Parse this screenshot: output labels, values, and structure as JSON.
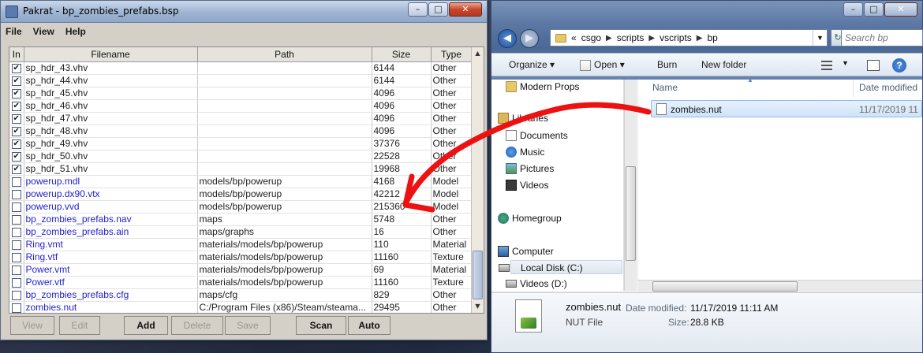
{
  "pakrat": {
    "title": "Pakrat - bp_zombies_prefabs.bsp",
    "menu": [
      "File",
      "View",
      "Help"
    ],
    "columns": [
      "In",
      "Filename",
      "Path",
      "Size",
      "Type"
    ],
    "rows": [
      {
        "checked": true,
        "name": "sp_hdr_43.vhv",
        "path": "",
        "size": "6144",
        "type": "Other"
      },
      {
        "checked": true,
        "name": "sp_hdr_44.vhv",
        "path": "",
        "size": "6144",
        "type": "Other"
      },
      {
        "checked": true,
        "name": "sp_hdr_45.vhv",
        "path": "",
        "size": "4096",
        "type": "Other"
      },
      {
        "checked": true,
        "name": "sp_hdr_46.vhv",
        "path": "",
        "size": "4096",
        "type": "Other"
      },
      {
        "checked": true,
        "name": "sp_hdr_47.vhv",
        "path": "",
        "size": "4096",
        "type": "Other"
      },
      {
        "checked": true,
        "name": "sp_hdr_48.vhv",
        "path": "",
        "size": "4096",
        "type": "Other"
      },
      {
        "checked": true,
        "name": "sp_hdr_49.vhv",
        "path": "",
        "size": "37376",
        "type": "Other"
      },
      {
        "checked": true,
        "name": "sp_hdr_50.vhv",
        "path": "",
        "size": "22528",
        "type": "Other"
      },
      {
        "checked": true,
        "name": "sp_hdr_51.vhv",
        "path": "",
        "size": "19968",
        "type": "Other"
      },
      {
        "checked": false,
        "name": "powerup.mdl",
        "path": "models/bp/powerup",
        "size": "4168",
        "type": "Model"
      },
      {
        "checked": false,
        "name": "powerup.dx90.vtx",
        "path": "models/bp/powerup",
        "size": "42212",
        "type": "Model"
      },
      {
        "checked": false,
        "name": "powerup.vvd",
        "path": "models/bp/powerup",
        "size": "215360",
        "type": "Model"
      },
      {
        "checked": false,
        "name": "bp_zombies_prefabs.nav",
        "path": "maps",
        "size": "5748",
        "type": "Other"
      },
      {
        "checked": false,
        "name": "bp_zombies_prefabs.ain",
        "path": "maps/graphs",
        "size": "16",
        "type": "Other"
      },
      {
        "checked": false,
        "name": "Ring.vmt",
        "path": "materials/models/bp/powerup",
        "size": "110",
        "type": "Material"
      },
      {
        "checked": false,
        "name": "Ring.vtf",
        "path": "materials/models/bp/powerup",
        "size": "11160",
        "type": "Texture"
      },
      {
        "checked": false,
        "name": "Power.vmt",
        "path": "materials/models/bp/powerup",
        "size": "69",
        "type": "Material"
      },
      {
        "checked": false,
        "name": "Power.vtf",
        "path": "materials/models/bp/powerup",
        "size": "11160",
        "type": "Texture"
      },
      {
        "checked": false,
        "name": "bp_zombies_prefabs.cfg",
        "path": "maps/cfg",
        "size": "829",
        "type": "Other"
      },
      {
        "checked": false,
        "name": "zombies.nut",
        "path": "C:/Program Files (x86)/Steam/steama...",
        "size": "29495",
        "type": "Other"
      }
    ],
    "buttons": {
      "view": "View",
      "edit": "Edit",
      "add": "Add",
      "delete": "Delete",
      "save": "Save",
      "scan": "Scan",
      "auto": "Auto"
    }
  },
  "explorer": {
    "breadcrumb": [
      "«",
      "csgo",
      "scripts",
      "vscripts",
      "bp"
    ],
    "search_placeholder": "Search bp",
    "toolbar": {
      "organize": "Organize",
      "open": "Open",
      "burn": "Burn",
      "new_folder": "New folder"
    },
    "nav": {
      "modern_props": "Modern Props",
      "libraries": "Libraries",
      "documents": "Documents",
      "music": "Music",
      "pictures": "Pictures",
      "videos": "Videos",
      "homegroup": "Homegroup",
      "computer": "Computer",
      "local_disk": "Local Disk (C:)",
      "videos_d": "Videos (D:)"
    },
    "list": {
      "col_name": "Name",
      "col_date": "Date modified",
      "file_name": "zombies.nut",
      "file_date": "11/17/2019 11"
    },
    "details": {
      "name": "zombies.nut",
      "type": "NUT File",
      "date_label": "Date modified:",
      "date_value": "11/17/2019 11:11 AM",
      "size_label": "Size:",
      "size_value": "28.8 KB"
    }
  },
  "colors": {
    "annotation": "#ee1111",
    "unchecked_text": "#2222cc",
    "selection": "#cfe3f8"
  }
}
